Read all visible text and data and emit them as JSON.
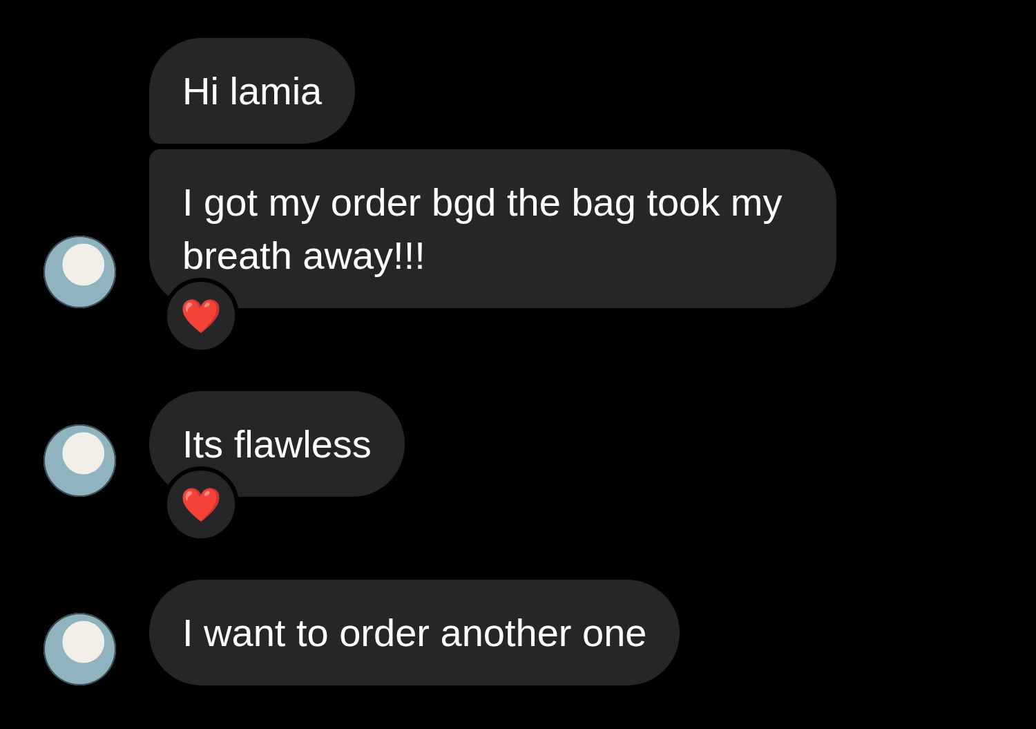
{
  "messages": [
    {
      "text": "Hi lamia",
      "show_avatar": false
    },
    {
      "text": "I got my order bgd the bag took my breath away!!!",
      "show_avatar": true,
      "reaction": "❤️"
    },
    {
      "text": "Its flawless",
      "show_avatar": true,
      "reaction": "❤️"
    },
    {
      "text": "I want to order another one",
      "show_avatar": true
    }
  ]
}
